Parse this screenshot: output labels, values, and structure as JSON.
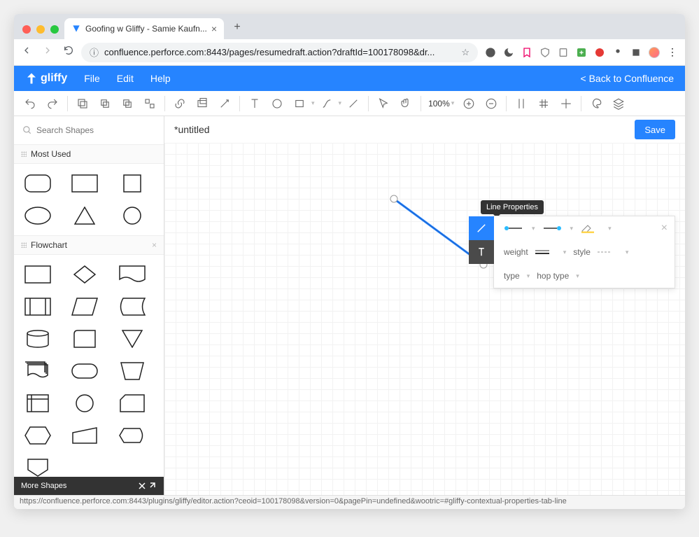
{
  "browser": {
    "tab_title": "Goofing w Gliffy - Samie Kaufn...",
    "url": "confluence.perforce.com:8443/pages/resumedraft.action?draftId=100178098&dr..."
  },
  "app": {
    "logo": "gliffy",
    "menu": {
      "file": "File",
      "edit": "Edit",
      "help": "Help"
    },
    "back_link": "< Back to Confluence",
    "toolbar": {
      "zoom": "100%"
    },
    "doc_title": "*untitled",
    "save_label": "Save"
  },
  "sidebar": {
    "search_placeholder": "Search Shapes",
    "sections": {
      "most_used": "Most Used",
      "flowchart": "Flowchart"
    },
    "more_shapes": "More Shapes"
  },
  "popup": {
    "tooltip": "Line Properties",
    "labels": {
      "weight": "weight",
      "style": "style",
      "type": "type",
      "hop_type": "hop type"
    }
  },
  "status_bar": "https://confluence.perforce.com:8443/plugins/gliffy/editor.action?ceoid=100178098&version=0&pagePin=undefined&wootric=#gliffy-contextual-properties-tab-line"
}
